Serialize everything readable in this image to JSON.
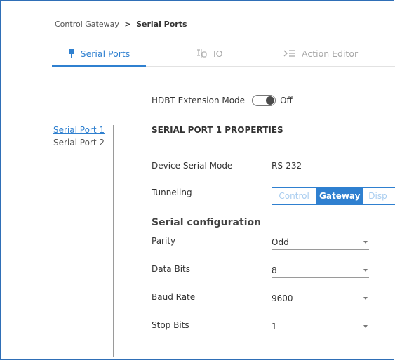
{
  "breadcrumb": {
    "parent": "Control Gateway",
    "separator": ">",
    "current": "Serial Ports"
  },
  "tabs": [
    {
      "label": "Serial Ports",
      "icon": "plug-icon",
      "active": true
    },
    {
      "label": "IO",
      "icon": "io-icon",
      "active": false
    },
    {
      "label": "Action Editor",
      "icon": "action-editor-icon",
      "active": false
    }
  ],
  "extension_mode": {
    "label": "HDBT Extension Mode",
    "state": "Off"
  },
  "ports": [
    {
      "label": "Serial Port 1",
      "active": true
    },
    {
      "label": "Serial Port 2",
      "active": false
    }
  ],
  "properties": {
    "title": "SERIAL PORT 1 PROPERTIES",
    "device_serial_mode": {
      "label": "Device Serial Mode",
      "value": "RS-232"
    },
    "tunneling": {
      "label": "Tunneling",
      "options": [
        "Control",
        "Gateway",
        "Disp"
      ],
      "selected": "Gateway"
    },
    "section_title": "Serial configuration",
    "parity": {
      "label": "Parity",
      "value": "Odd"
    },
    "data_bits": {
      "label": "Data Bits",
      "value": "8"
    },
    "baud_rate": {
      "label": "Baud Rate",
      "value": "9600"
    },
    "stop_bits": {
      "label": "Stop Bits",
      "value": "1"
    }
  },
  "colors": {
    "accent": "#2f80d0",
    "frame_border": "#2f6fb7"
  }
}
